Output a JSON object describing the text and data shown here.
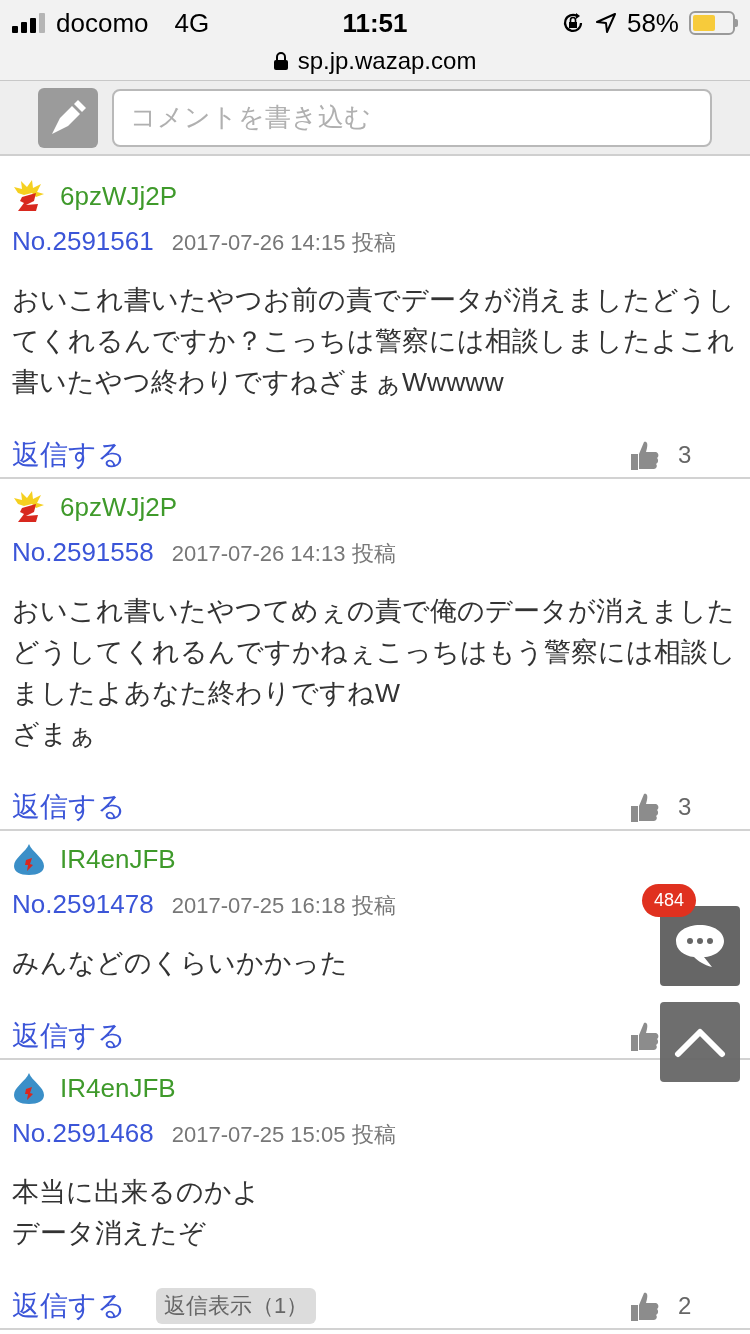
{
  "status_bar": {
    "carrier": "docomo",
    "network": "4G",
    "time": "11:51",
    "battery": "58%"
  },
  "address_bar": {
    "url": "sp.jp.wazap.com"
  },
  "comment_bar": {
    "placeholder": "コメントを書き込む"
  },
  "posts": [
    {
      "avatar": {
        "kind": "flame"
      },
      "user": "6pzWJj2P",
      "number": "No.2591561",
      "date": "2017-07-26 14:15 投稿",
      "body": [
        "おいこれ書いたやつお前の責でデータが消えましたどうしてくれるんですか？こっちは警察には相談しましたよこれ書いたやつ終わりですねざまぁWwwww"
      ],
      "reply": "返信する",
      "likes": "3"
    },
    {
      "avatar": {
        "kind": "flame"
      },
      "user": "6pzWJj2P",
      "number": "No.2591558",
      "date": "2017-07-26 14:13 投稿",
      "body": [
        "おいこれ書いたやつてめぇの責で俺のデータが消えましたどうしてくれるんですかねぇこっちはもう警察には相談しましたよあなた終わりですねW",
        "ざまぁ"
      ],
      "reply": "返信する",
      "likes": "3"
    },
    {
      "avatar": {
        "kind": "drop"
      },
      "user": "IR4enJFB",
      "number": "No.2591478",
      "date": "2017-07-25 16:18 投稿",
      "body": [
        "みんなどのくらいかかった"
      ],
      "reply": "返信する"
    },
    {
      "avatar": {
        "kind": "drop"
      },
      "user": "IR4enJFB",
      "number": "No.2591468",
      "date": "2017-07-25 15:05 投稿",
      "body": [
        "本当に出来るのかよ",
        "データ消えたぞ"
      ],
      "reply": "返信する",
      "show_replies": "返信表示（1）",
      "likes": "2"
    }
  ],
  "floating": {
    "comment_count": "484"
  }
}
